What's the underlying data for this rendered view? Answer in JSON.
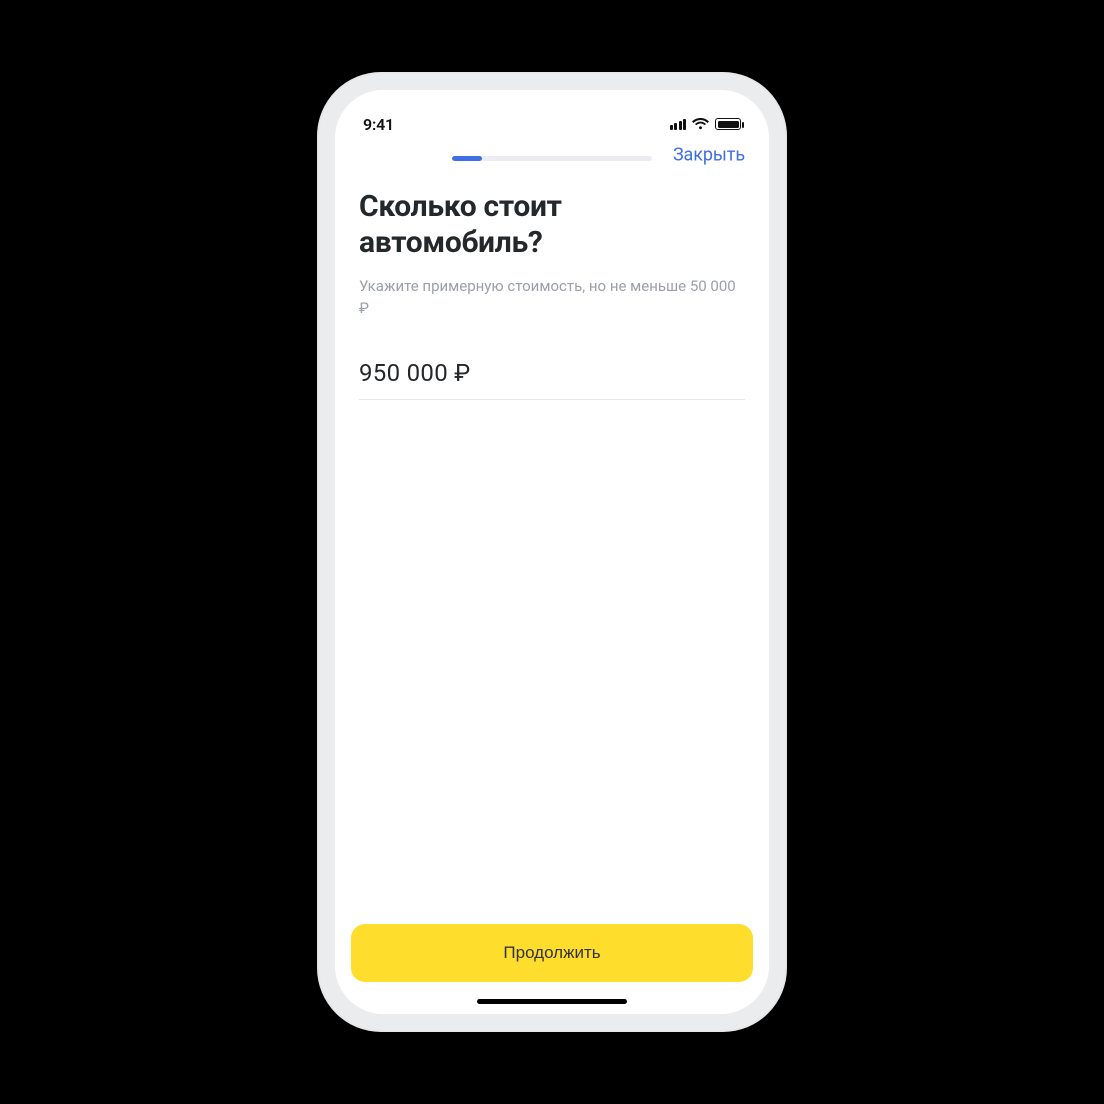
{
  "status": {
    "time": "9:41"
  },
  "header": {
    "close": "Закрыть",
    "progress_percent": 15
  },
  "main": {
    "title": "Сколько стоит автомобиль?",
    "subtitle": "Укажите примерную стоимость, но не меньше 50 000 ₽",
    "amount": "950 000 ₽"
  },
  "footer": {
    "continue": "Продолжить"
  },
  "colors": {
    "accent_blue": "#3F6FE3",
    "primary_yellow": "#FFDD2D"
  }
}
